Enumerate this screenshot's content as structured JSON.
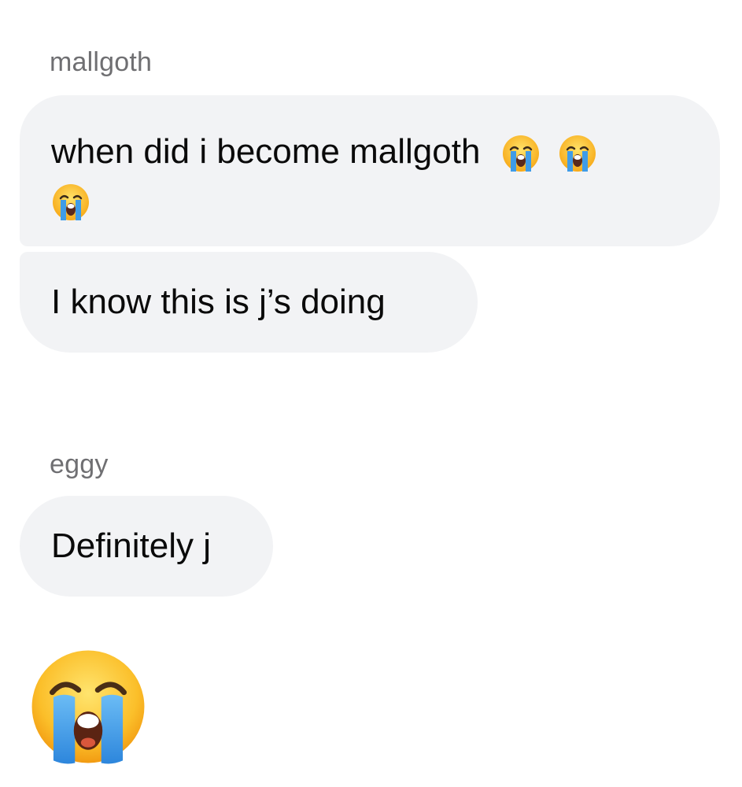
{
  "conversation": {
    "groups": [
      {
        "sender": "mallgoth",
        "messages": [
          {
            "text_line1": "when did i become mallgoth",
            "emoji": "loudly-crying-face",
            "emoji_count": 3
          },
          {
            "text": "I know this is j’s doing"
          }
        ]
      },
      {
        "sender": "eggy",
        "messages": [
          {
            "text": "Definitely j"
          },
          {
            "emoji_only": "loudly-crying-face"
          }
        ]
      }
    ]
  },
  "colors": {
    "bubble_bg": "#f2f3f5",
    "sender_text": "#6f6f72",
    "message_text": "#0a0a0a",
    "page_bg": "#ffffff"
  }
}
